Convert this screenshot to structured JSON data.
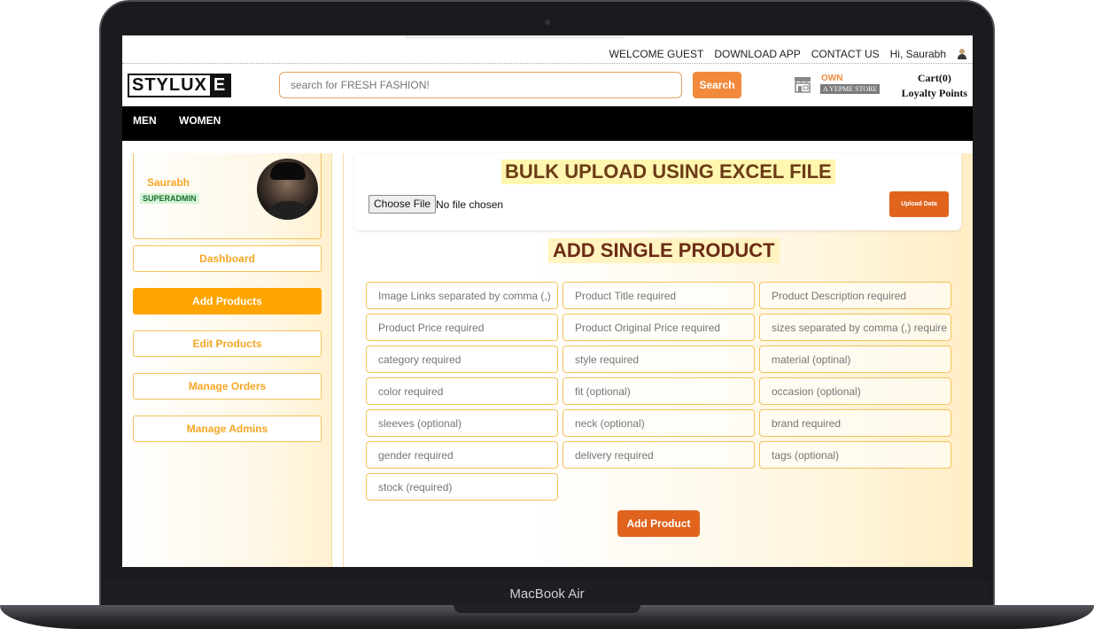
{
  "device": {
    "label": "MacBook Air"
  },
  "topbar": {
    "links": [
      "WELCOME GUEST",
      "DOWNLOAD APP",
      "CONTACT US",
      "Hi, Saurabh"
    ]
  },
  "header": {
    "logo_main": "STYLUX",
    "logo_box": "E",
    "search_placeholder": "search for FRESH FASHION!",
    "search_label": "Search",
    "store_own": "OWN",
    "store_sub": "A YEPME STORE",
    "cart": "Cart(0)",
    "loyalty": "Loyalty Points"
  },
  "nav": {
    "items": [
      "MEN",
      "WOMEN"
    ]
  },
  "sidebar": {
    "user_name": "Saurabh",
    "user_role": "SUPERADMIN",
    "items": [
      "Dashboard",
      "Add Products",
      "Edit Products",
      "Manage Orders",
      "Manage Admins"
    ],
    "active": "Add Products"
  },
  "bulk": {
    "title": "BULK UPLOAD USING EXCEL FILE",
    "choose_label": "Choose File",
    "no_file": "No file chosen",
    "upload_label": "Upload Data"
  },
  "single": {
    "title": "ADD SINGLE PRODUCT",
    "fields": [
      "Image Links separated by comma (,)",
      "Product Title required",
      "Product Description required",
      "Product Price required",
      "Product Original Price required",
      "sizes separated by comma (,) require",
      "category required",
      "style required",
      "material (optinal)",
      "color required",
      "fit (optional)",
      "occasion (optional)",
      "sleeves (optional)",
      "neck (optional)",
      "brand required",
      "gender required",
      "delivery required",
      "tags (optional)",
      "stock (required)"
    ],
    "submit_label": "Add Product"
  },
  "colors": {
    "accent": "#f18a3c",
    "active": "#ffa400",
    "button": "#e0631e"
  }
}
